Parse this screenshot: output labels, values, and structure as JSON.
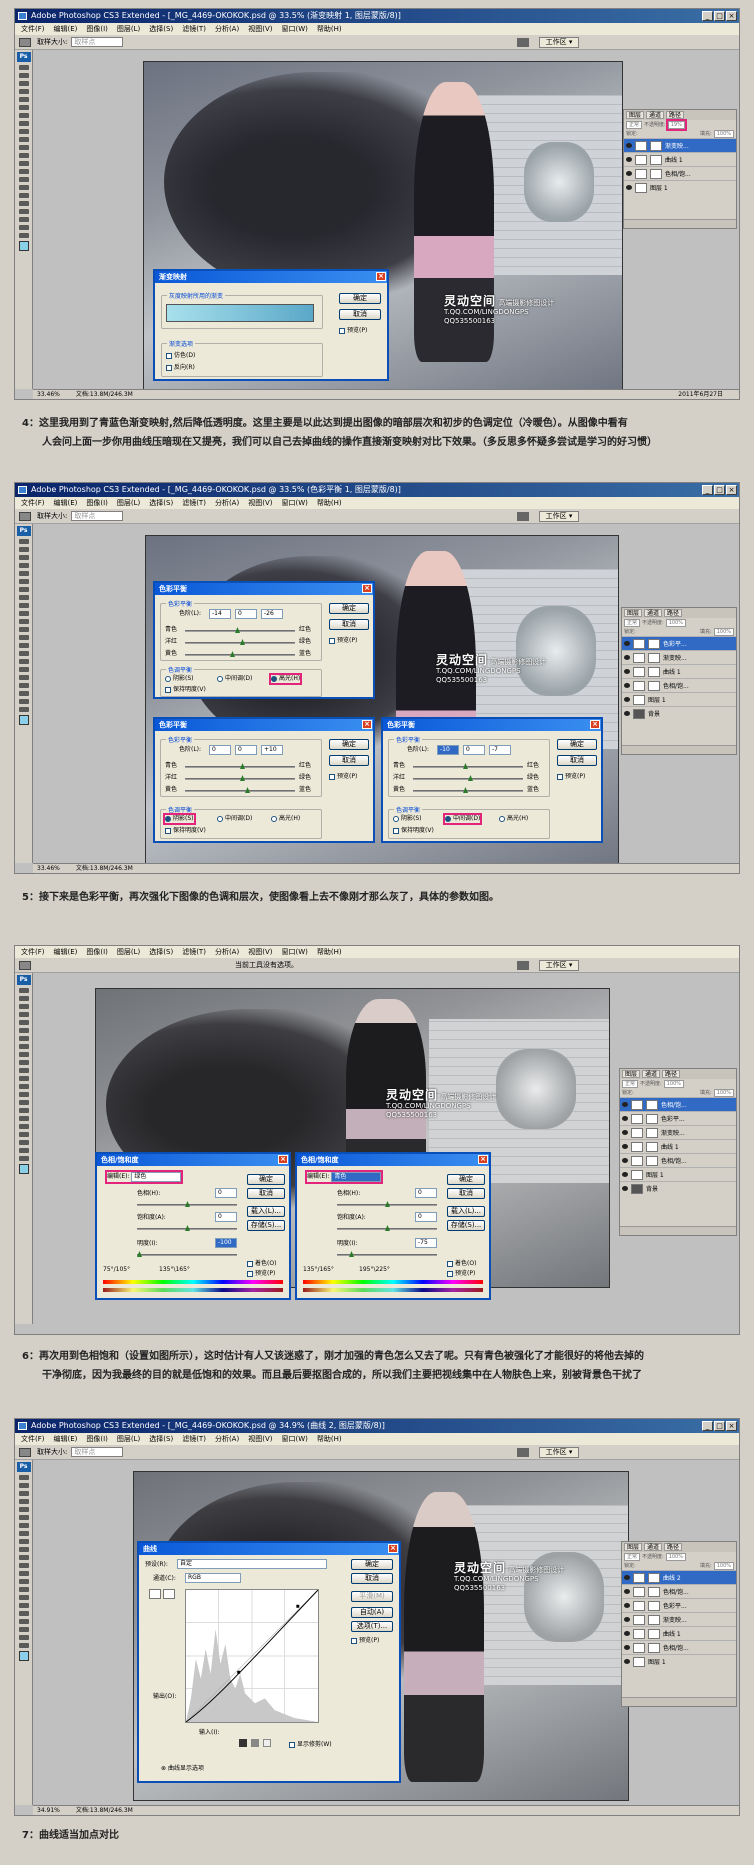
{
  "app": {
    "menu": [
      "文件(F)",
      "编辑(E)",
      "图像(I)",
      "图层(L)",
      "选择(S)",
      "滤镜(T)",
      "分析(A)",
      "视图(V)",
      "窗口(W)",
      "帮助(H)"
    ],
    "brush_size_label": "取样大小:",
    "brush_size_value": "取样点",
    "workspace_label": "工作区 ▾",
    "colors": {
      "titlebar": "#0a246a",
      "highlight": "#e2247a",
      "dialog_title": "#0a58d8"
    }
  },
  "watermark": {
    "brand": "灵动空间",
    "subtitle": "高端摄影修图设计",
    "url": "T.QQ.COM/LINGDONGPS",
    "qq": "QQ535500163"
  },
  "shot1": {
    "title": "Adobe Photoshop CS3 Extended - [_MG_4469-OKOKOK.psd @ 33.5% (渐变映射 1, 图层蒙版/8)]",
    "zoom": "33.46%",
    "doc": "文档:13.8M/246.3M",
    "date": "2011年6月27日",
    "dialog": {
      "title": "渐变映射",
      "group1": "灰度映射所用的渐变",
      "group2": "渐变选项",
      "dither": "仿色(D)",
      "reverse": "反向(R)",
      "ok": "确定",
      "cancel": "取消",
      "preview": "预览(P)"
    },
    "layers": {
      "tabs": [
        "图层",
        "通道",
        "路径"
      ],
      "blend": "正常",
      "opacity_label": "不透明度:",
      "opacity": "19%",
      "lock_label": "锁定:",
      "fill_label": "填充:",
      "fill": "100%",
      "items": [
        {
          "name": "渐变映..."
        },
        {
          "name": "曲线 1"
        },
        {
          "name": "色相/饱..."
        },
        {
          "name": "图层 1"
        }
      ]
    }
  },
  "caption1": [
    "4：这里我用到了青蓝色渐变映射,然后降低透明度。这里主要是以此达到提出图像的暗部层次和初步的色调定位（冷暖色）。从图像中看有",
    "人会问上面一步你用曲线压暗现在又提亮，我们可以自己去掉曲线的操作直接渐变映射对比下效果。（多反思多怀疑多尝试是学习的好习惯）"
  ],
  "shot2": {
    "title": "Adobe Photoshop CS3 Extended - [_MG_4469-OKOKOK.psd @ 33.5% (色彩平衡 1, 图层蒙版/8)]",
    "zoom": "33.46%",
    "doc": "文档:13.8M/246.3M",
    "dialogs": [
      {
        "title": "色彩平衡",
        "group": "色彩平衡",
        "levels_label": "色阶(L):",
        "v1": "-14",
        "v2": "0",
        "v3": "-26",
        "tone_group": "色调平衡",
        "shadow": "阴影(S)",
        "mid": "中间调(D)",
        "high": "高光(H)",
        "preserve": "保持明度(V)",
        "active": "high"
      },
      {
        "title": "色彩平衡",
        "group": "色彩平衡",
        "levels_label": "色阶(L):",
        "v1": "0",
        "v2": "0",
        "v3": "+10",
        "tone_group": "色调平衡",
        "shadow": "阴影(S)",
        "mid": "中间调(D)",
        "high": "高光(H)",
        "preserve": "保持明度(V)",
        "active": "shadow"
      },
      {
        "title": "色彩平衡",
        "group": "色彩平衡",
        "levels_label": "色阶(L):",
        "v1": "-10",
        "v2": "0",
        "v3": "-7",
        "tone_group": "色调平衡",
        "shadow": "阴影(S)",
        "mid": "中间调(D)",
        "high": "高光(H)",
        "preserve": "保持明度(V)",
        "active": "mid"
      }
    ],
    "sliders": {
      "c": "青色",
      "r": "红色",
      "m": "洋红",
      "g": "绿色",
      "y": "黄色",
      "b": "蓝色"
    },
    "ok": "确定",
    "cancel": "取消",
    "preview": "预览(P)",
    "layers": {
      "tabs": [
        "图层",
        "通道",
        "路径"
      ],
      "blend": "正常",
      "opacity_label": "不透明度:",
      "opacity": "100%",
      "lock_label": "锁定:",
      "fill_label": "填充:",
      "fill": "100%",
      "items": [
        {
          "name": "色彩平..."
        },
        {
          "name": "渐变映..."
        },
        {
          "name": "曲线 1"
        },
        {
          "name": "色相/饱..."
        },
        {
          "name": "图层 1"
        },
        {
          "name": "背景"
        }
      ]
    }
  },
  "caption2": [
    "5：接下来是色彩平衡，再次强化下图像的色调和层次，使图像看上去不像刚才那么灰了，具体的参数如图。"
  ],
  "shot3": {
    "status_msg": "当前工具没有选项。",
    "dialogs": [
      {
        "title": "色相/饱和度",
        "edit_label": "编辑(E):",
        "edit_value": "绿色",
        "hue_label": "色相(H):",
        "hue": "0",
        "sat_label": "饱和度(A):",
        "sat": "0",
        "light_label": "明度(I):",
        "light": "-100",
        "range1": "75°/105°",
        "range2": "135°\\165°",
        "colorize": "着色(O)",
        "preview": "预览(P)"
      },
      {
        "title": "色相/饱和度",
        "edit_label": "编辑(E):",
        "edit_value": "青色",
        "hue_label": "色相(H):",
        "hue": "0",
        "sat_label": "饱和度(A):",
        "sat": "0",
        "light_label": "明度(I):",
        "light": "-75",
        "range1": "135°/165°",
        "range2": "195°\\225°",
        "colorize": "着色(O)",
        "preview": "预览(P)"
      }
    ],
    "ok": "确定",
    "cancel": "取消",
    "load": "载入(L)...",
    "save": "存储(S)...",
    "layers": {
      "tabs": [
        "图层",
        "通道",
        "路径"
      ],
      "blend": "正常",
      "opacity_label": "不透明度:",
      "opacity": "100%",
      "lock_label": "锁定:",
      "fill_label": "填充:",
      "fill": "100%",
      "items": [
        {
          "name": "色相/饱..."
        },
        {
          "name": "色彩平..."
        },
        {
          "name": "渐变映..."
        },
        {
          "name": "曲线 1"
        },
        {
          "name": "色相/饱..."
        },
        {
          "name": "图层 1"
        },
        {
          "name": "背景"
        }
      ]
    }
  },
  "caption3": [
    "6：再次用到色相饱和（设置如图所示），这时估计有人又该迷惑了，刚才加强的青色怎么又去了呢。只有青色被强化了才能很好的将他去掉的",
    "干净彻底，因为我最终的目的就是低饱和的效果。而且最后要抠图合成的，所以我们主要把视线集中在人物肤色上来，别被背景色干扰了"
  ],
  "shot4": {
    "title": "Adobe Photoshop CS3 Extended - [_MG_4469-OKOKOK.psd @ 34.9% (曲线 2, 图层蒙版/8)]",
    "zoom": "34.91%",
    "doc": "文档:13.8M/246.3M",
    "dialog": {
      "title": "曲线",
      "preset_label": "预设(R):",
      "preset_value": "自定",
      "channel_label": "通道(C):",
      "channel_value": "RGB",
      "output": "输出(O):",
      "input": "输入(I):",
      "show_clip": "显示修剪(W)",
      "display_opts": "曲线显示选项",
      "ok": "确定",
      "cancel": "取消",
      "smooth": "平滑(M)",
      "auto": "自动(A)",
      "options": "选项(T)...",
      "preview": "预览(P)"
    },
    "layers": {
      "tabs": [
        "图层",
        "通道",
        "路径"
      ],
      "blend": "正常",
      "opacity_label": "不透明度:",
      "opacity": "100%",
      "lock_label": "锁定:",
      "fill_label": "填充:",
      "fill": "100%",
      "items": [
        {
          "name": "曲线 2"
        },
        {
          "name": "色相/饱..."
        },
        {
          "name": "色彩平..."
        },
        {
          "name": "渐变映..."
        },
        {
          "name": "曲线 1"
        },
        {
          "name": "色相/饱..."
        },
        {
          "name": "图层 1"
        }
      ]
    }
  },
  "caption4": [
    "7：曲线适当加点对比"
  ]
}
